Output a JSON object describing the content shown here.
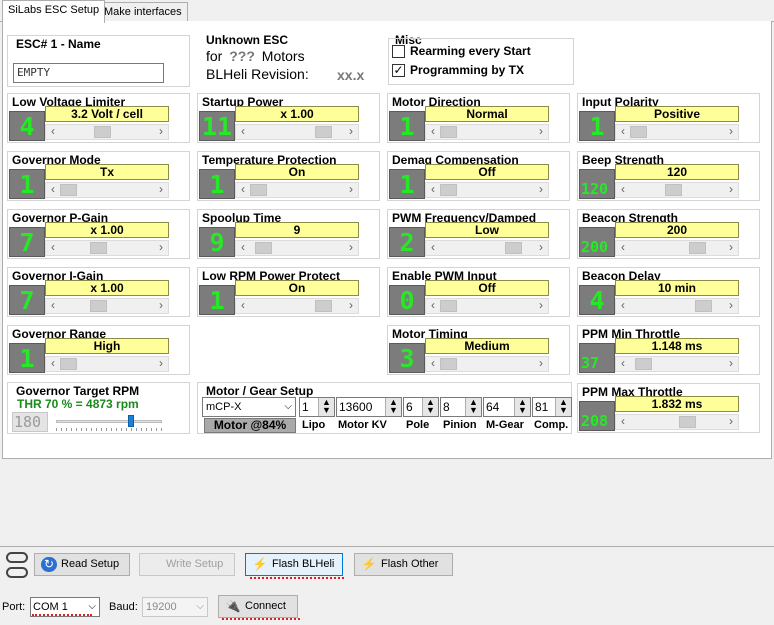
{
  "tabs": [
    {
      "label": "SiLabs ESC Setup"
    },
    {
      "label": "Make interfaces"
    }
  ],
  "esc_name": {
    "title": "ESC# 1 - Name",
    "value": "EMPTY"
  },
  "unknown_esc": {
    "title": "Unknown ESC",
    "for_label": "for",
    "motors_q": "???",
    "motors_label": "Motors",
    "rev_label": "BLHeli Revision:",
    "rev_value": "xx.x"
  },
  "misc": {
    "title": "Misc",
    "rearming": "Rearming every Start",
    "programming": "Programming by TX",
    "programming_check": "✓"
  },
  "panels": [
    {
      "title": "Low Voltage Limiter",
      "num": "4",
      "value": "3.2 Volt / cell",
      "thumb_pos": 0.45
    },
    {
      "title": "Startup Power",
      "num": "11",
      "value": "x 1.00",
      "thumb_pos": 0.85
    },
    {
      "title": "Motor Direction",
      "num": "1",
      "value": "Normal",
      "thumb_pos": 0.0
    },
    {
      "title": "Input Polarity",
      "num": "1",
      "value": "Positive",
      "thumb_pos": 0.0
    },
    {
      "title": "Governor Mode",
      "num": "1",
      "value": "Tx",
      "thumb_pos": 0.0
    },
    {
      "title": "Temperature Protection",
      "num": "1",
      "value": "On",
      "thumb_pos": 0.0
    },
    {
      "title": "Demag Compensation",
      "num": "1",
      "value": "Off",
      "thumb_pos": 0.0
    },
    {
      "title": "Beep Strength",
      "num": "120",
      "value": "120",
      "thumb_pos": 0.46
    },
    {
      "title": "Governor P-Gain",
      "num": "7",
      "value": "x 1.00",
      "thumb_pos": 0.4
    },
    {
      "title": "Spoolup Time",
      "num": "9",
      "value": "9",
      "thumb_pos": 0.07
    },
    {
      "title": "PWM Frequency/Damped",
      "num": "2",
      "value": "Low",
      "thumb_pos": 0.85
    },
    {
      "title": "Beacon Strength",
      "num": "200",
      "value": "200",
      "thumb_pos": 0.78
    },
    {
      "title": "Governor I-Gain",
      "num": "7",
      "value": "x 1.00",
      "thumb_pos": 0.4
    },
    {
      "title": "Low RPM Power Protect",
      "num": "1",
      "value": "On",
      "thumb_pos": 0.85
    },
    {
      "title": "Enable PWM Input",
      "num": "0",
      "value": "Off",
      "thumb_pos": 0.0
    },
    {
      "title": "Beacon Delay",
      "num": "4",
      "value": "10 min",
      "thumb_pos": 0.85
    },
    {
      "title": "Governor Range",
      "num": "1",
      "value": "High",
      "thumb_pos": 0.0
    },
    {
      "title": "Motor Timing",
      "num": "3",
      "value": "Medium",
      "thumb_pos": 0.0
    },
    {
      "title": "PPM Min Throttle",
      "num": "37",
      "value": "1.148 ms",
      "thumb_pos": 0.07
    },
    {
      "title": "PPM Max Throttle",
      "num": "208",
      "value": "1.832 ms",
      "thumb_pos": 0.65
    }
  ],
  "gov_target": {
    "title": "Governor Target RPM",
    "thr": "THR 70 % = 4873 rpm",
    "num": "180",
    "slider_pos": 0.72
  },
  "motor_gear": {
    "title": "Motor / Gear Setup",
    "model": "mCP-X",
    "motor_label": "Motor @84%",
    "lipo": "1",
    "motor_kv": "13600",
    "pole": "6",
    "pinion": "8",
    "mgear": "64",
    "comp": "81",
    "l_lipo": "Lipo",
    "l_kv": "Motor KV",
    "l_pole": "Pole",
    "l_pinion": "Pinion",
    "l_mgear": "M-Gear",
    "l_comp": "Comp."
  },
  "buttons": {
    "read": "Read Setup",
    "write": "Write Setup",
    "flash_blheli": "Flash BLHeli",
    "flash_other": "Flash Other",
    "connect": "Connect"
  },
  "port": {
    "label": "Port:",
    "value": "COM 1",
    "baud_label": "Baud:",
    "baud_value": "19200"
  }
}
